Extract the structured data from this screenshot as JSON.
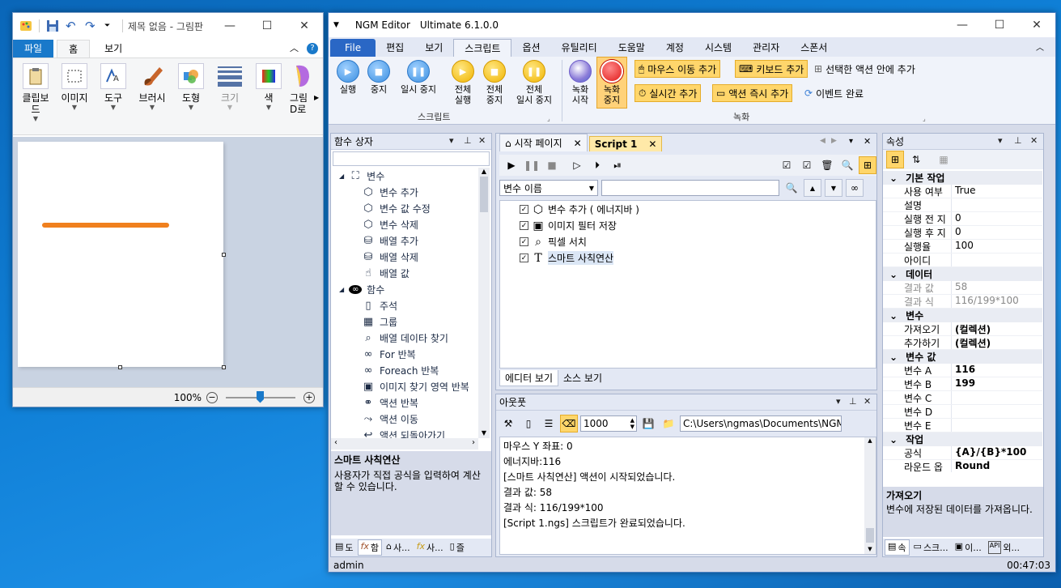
{
  "paint": {
    "title": "제목 없음 - 그림판",
    "tabs": [
      "파일",
      "홈",
      "보기"
    ],
    "ribbon_groups": [
      "클립보드",
      "이미지",
      "도구",
      "브러시",
      "도형",
      "크기",
      "색",
      "그림"
    ],
    "ribbon_group_extra": "D로",
    "zoom": "100%",
    "line_color": "#f0801e"
  },
  "ngm": {
    "app_name": "NGM Editor",
    "edition": "Ultimate 6.1.0.0",
    "menu": [
      "File",
      "편집",
      "보기",
      "스크립트",
      "옵션",
      "유틸리티",
      "도움말",
      "계정",
      "시스템",
      "관리자",
      "스폰서"
    ],
    "ribbon": {
      "run": "실행",
      "stop": "중지",
      "pause": "일시 중지",
      "run_all_1": "전체",
      "run_all_2": "실행",
      "stop_all_1": "전체",
      "stop_all_2": "중지",
      "pause_all_1": "전체",
      "pause_all_2": "일시 중지",
      "group_script": "스크립트",
      "rec_start_1": "녹화",
      "rec_start_2": "시작",
      "rec_stop_1": "녹화",
      "rec_stop_2": "중지",
      "add_mouse": "마우스 이동 추가",
      "add_keyboard": "키보드 추가",
      "add_in_selected": "선택한 액션 안에 추가",
      "add_realtime": "실시간 추가",
      "add_instant": "액션 즉시 추가",
      "event_complete": "이벤트 완료",
      "group_record": "녹화"
    },
    "function_box": {
      "title": "함수 상자",
      "tree": [
        {
          "label": "변수",
          "level": 0,
          "icon": "variable-group-icon"
        },
        {
          "label": "변수 추가",
          "level": 1,
          "icon": "cube-icon"
        },
        {
          "label": "변수 값 수정",
          "level": 1,
          "icon": "cube-icon"
        },
        {
          "label": "변수 삭제",
          "level": 1,
          "icon": "cube-icon"
        },
        {
          "label": "배열 추가",
          "level": 1,
          "icon": "database-icon"
        },
        {
          "label": "배열 삭제",
          "level": 1,
          "icon": "database-icon"
        },
        {
          "label": "배열 값",
          "level": 1,
          "icon": "pointer-icon"
        },
        {
          "label": "함수",
          "level": 0,
          "icon": "infinity-icon"
        },
        {
          "label": "주석",
          "level": 1,
          "icon": "page-icon"
        },
        {
          "label": "그룹",
          "level": 1,
          "icon": "cubes-icon"
        },
        {
          "label": "배열 데이타 찾기",
          "level": 1,
          "icon": "search-icon"
        },
        {
          "label": "For 반복",
          "level": 1,
          "icon": "loop-icon"
        },
        {
          "label": "Foreach 반복",
          "level": 1,
          "icon": "loop-icon"
        },
        {
          "label": "이미지 찾기 영역 반복",
          "level": 1,
          "icon": "image-loop-icon"
        },
        {
          "label": "액션 반복",
          "level": 1,
          "icon": "repeat-icon"
        },
        {
          "label": "액션 이동",
          "level": 1,
          "icon": "move-icon"
        },
        {
          "label": "액션 되돌아가기",
          "level": 1,
          "icon": "return-icon"
        }
      ],
      "desc_title": "스마트 사칙연산",
      "desc_text": "사용자가 직접 공식을 입력하여 계산할 수 있습니다.",
      "bottom_tabs": [
        "도",
        "함",
        "사...",
        "사...",
        "즐"
      ]
    },
    "editor": {
      "tabs": [
        "시작 페이지",
        "Script 1"
      ],
      "var_select": "변수 이름",
      "actions": [
        "변수 추가 ( 에너지바 )",
        "이미지 필터 저장",
        "픽셀 서치",
        "스마트 사칙연산"
      ],
      "bottom_tabs": [
        "에디터 보기",
        "소스 보기"
      ]
    },
    "output": {
      "title": "아웃풋",
      "count": "1000",
      "path": "C:\\Users\\ngmas\\Documents\\NGM6\\",
      "lines": [
        "마우스 Y 좌표: 0",
        "에너지바:116",
        "[스마트 사칙연산] 액션이 시작되었습니다.",
        "결과 값: 58",
        "결과 식: 116/199*100",
        "[Script 1.ngs] 스크립트가 완료되었습니다."
      ]
    },
    "properties": {
      "title": "속성",
      "categories": [
        {
          "name": "기본 작업",
          "rows": [
            [
              "사용 여부",
              "True"
            ],
            [
              "설명",
              ""
            ],
            [
              "실행 전 지",
              "0"
            ],
            [
              "실행 후 지",
              "0"
            ],
            [
              "실행율",
              "100"
            ],
            [
              "아이디",
              ""
            ]
          ]
        },
        {
          "name": "데이터",
          "rows": [
            [
              "결과 값",
              "58"
            ],
            [
              "결과 식",
              "116/199*100"
            ]
          ]
        },
        {
          "name": "변수",
          "rows": [
            [
              "가져오기",
              "(컬렉션)"
            ],
            [
              "추가하기",
              "(컬렉션)"
            ]
          ]
        },
        {
          "name": "변수 값",
          "rows": [
            [
              "변수 A",
              "116"
            ],
            [
              "변수 B",
              "199"
            ],
            [
              "변수 C",
              ""
            ],
            [
              "변수 D",
              ""
            ],
            [
              "변수 E",
              ""
            ]
          ]
        },
        {
          "name": "작업",
          "rows": [
            [
              "공식",
              "{A}/{B}*100"
            ],
            [
              "라운드 옵",
              "Round"
            ]
          ]
        }
      ],
      "desc_title": "가져오기",
      "desc_text": "변수에 저장된 데이터를 가져옵니다.",
      "bottom_tabs": [
        "속",
        "스크...",
        "이...",
        "외..."
      ]
    },
    "status": {
      "user": "admin",
      "time": "00:47:03"
    }
  }
}
